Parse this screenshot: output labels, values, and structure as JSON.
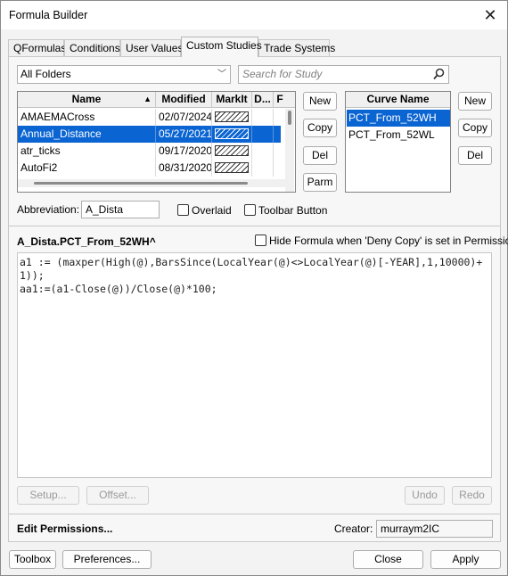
{
  "window": {
    "title": "Formula Builder"
  },
  "tabs": [
    "QFormulas",
    "Conditions",
    "User Values",
    "Custom Studies",
    "Trade Systems"
  ],
  "active_tab": "Custom Studies",
  "folder": {
    "value": "All Folders"
  },
  "search": {
    "placeholder": "Search for Study"
  },
  "studies": {
    "columns": [
      "Name",
      "Modified",
      "MarkIt",
      "D...",
      "F"
    ],
    "rows": [
      {
        "name": "AMAEMACross",
        "modified": "02/07/2024",
        "selected": false
      },
      {
        "name": "Annual_Distance",
        "modified": "05/27/2021",
        "selected": true
      },
      {
        "name": "atr_ticks",
        "modified": "09/17/2020",
        "selected": false
      },
      {
        "name": "AutoFi2",
        "modified": "08/31/2020",
        "selected": false
      }
    ]
  },
  "study_buttons": {
    "new": "New",
    "copy": "Copy",
    "del": "Del",
    "parm": "Parm"
  },
  "curves": {
    "header": "Curve Name",
    "items": [
      {
        "name": "PCT_From_52WH",
        "selected": true
      },
      {
        "name": "PCT_From_52WL",
        "selected": false
      }
    ]
  },
  "curve_buttons": {
    "new": "New",
    "copy": "Copy",
    "del": "Del"
  },
  "abbreviation": {
    "label": "Abbreviation:",
    "value": "A_Dista"
  },
  "overlaid": {
    "label": "Overlaid",
    "checked": false
  },
  "toolbar_button": {
    "label": "Toolbar Button",
    "checked": false
  },
  "formula_title": "A_Dista.PCT_From_52WH^",
  "hide_formula": {
    "label": "Hide Formula when 'Deny Copy' is set in Permissions",
    "checked": false
  },
  "formula_lines": [
    "a1 := (maxper(High(@),BarsSince(LocalYear(@)<>LocalYear(@)[-YEAR],1,10000)+",
    "1));",
    "aa1:=(a1-Close(@))/Close(@)*100;"
  ],
  "editor_buttons": {
    "setup": "Setup...",
    "offset": "Offset...",
    "undo": "Undo",
    "redo": "Redo"
  },
  "permissions": {
    "label": "Edit Permissions..."
  },
  "creator": {
    "label": "Creator:",
    "value": "murraym2IC"
  },
  "footer": {
    "toolbox": "Toolbox",
    "preferences": "Preferences...",
    "close": "Close",
    "apply": "Apply"
  }
}
